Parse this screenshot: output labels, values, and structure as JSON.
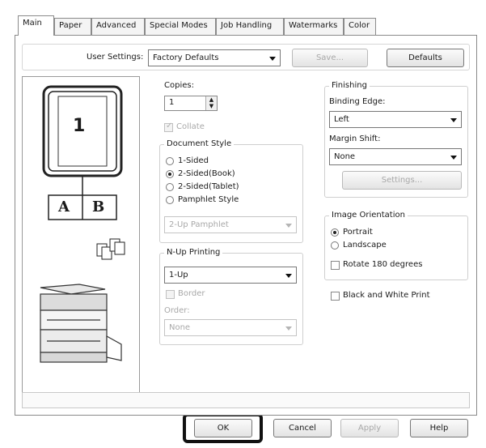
{
  "tabs": [
    {
      "label": "Main"
    },
    {
      "label": "Paper"
    },
    {
      "label": "Advanced"
    },
    {
      "label": "Special Modes"
    },
    {
      "label": "Job Handling"
    },
    {
      "label": "Watermarks"
    },
    {
      "label": "Color"
    }
  ],
  "user_settings": {
    "label": "User Settings:",
    "value": "Factory Defaults",
    "save_label": "Save...",
    "defaults_label": "Defaults"
  },
  "preview": {
    "page_number": "1",
    "book_left": "A",
    "book_right": "B"
  },
  "copies": {
    "label": "Copies:",
    "value": "1",
    "collate_label": "Collate",
    "collate_checked": true
  },
  "document_style": {
    "legend": "Document Style",
    "options": [
      {
        "label": "1-Sided",
        "checked": false
      },
      {
        "label": "2-Sided(Book)",
        "checked": true
      },
      {
        "label": "2-Sided(Tablet)",
        "checked": false
      },
      {
        "label": "Pamphlet Style",
        "checked": false
      }
    ],
    "pamphlet_value": "2-Up Pamphlet"
  },
  "nup": {
    "legend": "N-Up Printing",
    "value": "1-Up",
    "border_label": "Border",
    "order_label": "Order:",
    "order_value": "None"
  },
  "finishing": {
    "legend": "Finishing",
    "binding_edge_label": "Binding Edge:",
    "binding_edge_value": "Left",
    "margin_shift_label": "Margin Shift:",
    "margin_shift_value": "None",
    "settings_label": "Settings..."
  },
  "orientation": {
    "legend": "Image Orientation",
    "portrait_label": "Portrait",
    "landscape_label": "Landscape",
    "rotate_label": "Rotate 180 degrees"
  },
  "bw_print_label": "Black and White Print",
  "footer": {
    "ok_label": "OK",
    "cancel_label": "Cancel",
    "apply_label": "Apply",
    "help_label": "Help"
  },
  "colors": {
    "highlight": "#111111",
    "disabled_text": "#a8a8a8"
  }
}
